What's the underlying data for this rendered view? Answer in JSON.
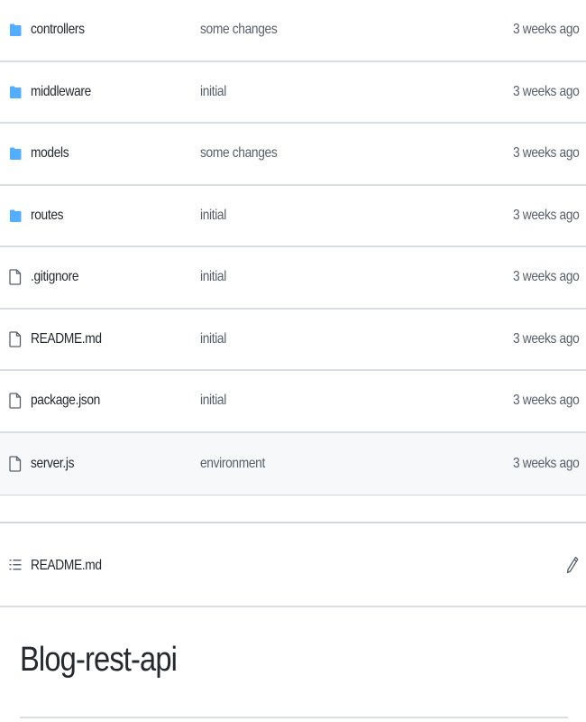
{
  "files": [
    {
      "type": "folder",
      "icon": "folder-icon",
      "name": "controllers",
      "commit": "some changes",
      "age": "3 weeks ago"
    },
    {
      "type": "folder",
      "icon": "folder-icon",
      "name": "middleware",
      "commit": "initial",
      "age": "3 weeks ago"
    },
    {
      "type": "folder",
      "icon": "folder-icon",
      "name": "models",
      "commit": "some changes",
      "age": "3 weeks ago"
    },
    {
      "type": "folder",
      "icon": "folder-icon",
      "name": "routes",
      "commit": "initial",
      "age": "3 weeks ago"
    },
    {
      "type": "file",
      "icon": "file-icon",
      "name": ".gitignore",
      "commit": "initial",
      "age": "3 weeks ago"
    },
    {
      "type": "file",
      "icon": "file-icon",
      "name": "README.md",
      "commit": "initial",
      "age": "3 weeks ago"
    },
    {
      "type": "file",
      "icon": "file-icon",
      "name": "package.json",
      "commit": "initial",
      "age": "3 weeks ago"
    },
    {
      "type": "file",
      "icon": "file-icon",
      "name": "server.js",
      "commit": "environment",
      "age": "3 weeks ago"
    }
  ],
  "readme": {
    "header_title": "README.md",
    "header_icon": "list-unordered-icon",
    "edit_icon": "pencil-icon",
    "heading": "Blog-rest-api"
  },
  "colors": {
    "folder": "#54aeff",
    "text": "#24292f",
    "muted": "#57606a",
    "border": "#d8dee4"
  }
}
